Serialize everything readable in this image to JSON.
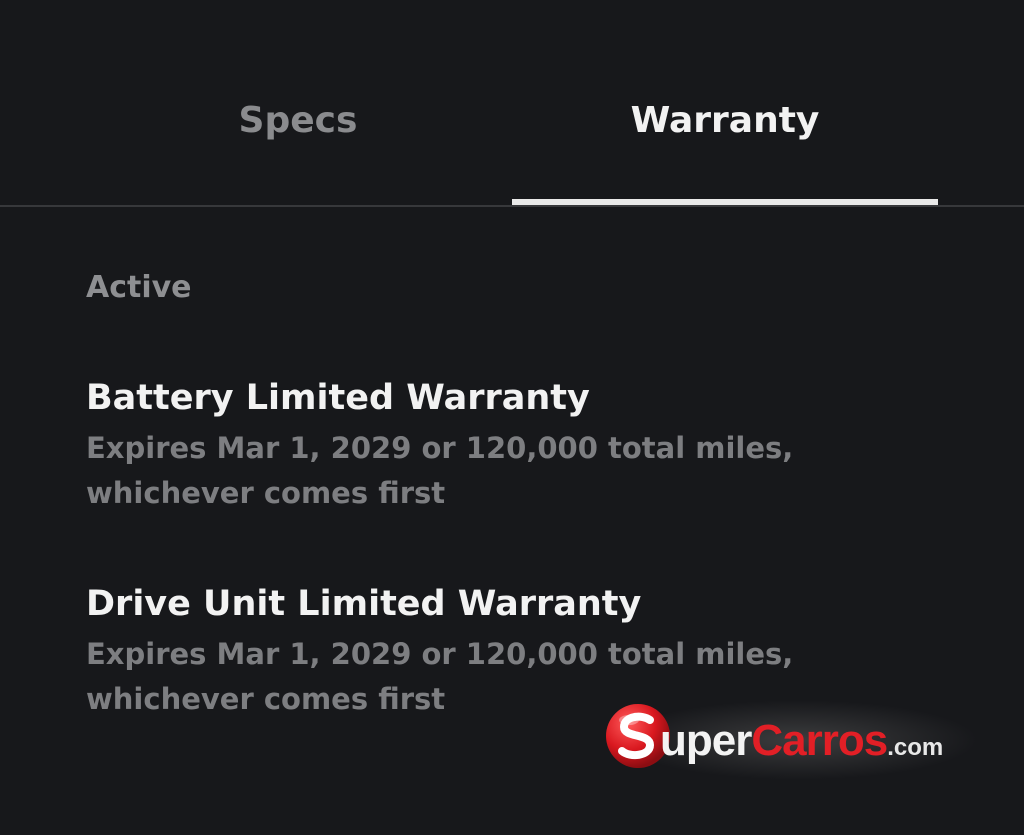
{
  "tabs": [
    {
      "label": "Specs",
      "active": false
    },
    {
      "label": "Warranty",
      "active": true
    }
  ],
  "section": {
    "label": "Active"
  },
  "warranties": [
    {
      "title": "Battery Limited Warranty",
      "description": "Expires Mar 1, 2029 or 120,000 total miles, whichever comes first"
    },
    {
      "title": "Drive Unit Limited Warranty",
      "description": "Expires Mar 1, 2029 or 120,000 total miles, whichever comes first"
    }
  ],
  "watermark": {
    "text": "SuperCarros.com",
    "part_per": "uper",
    "part_carros": "Carros",
    "part_com": ".com",
    "brand_red": "#e21f26"
  },
  "colors": {
    "background": "#17181b",
    "active_tab": "#f2f2f2",
    "inactive_tab": "#8a8b8e",
    "secondary_text": "#7d7e81"
  }
}
